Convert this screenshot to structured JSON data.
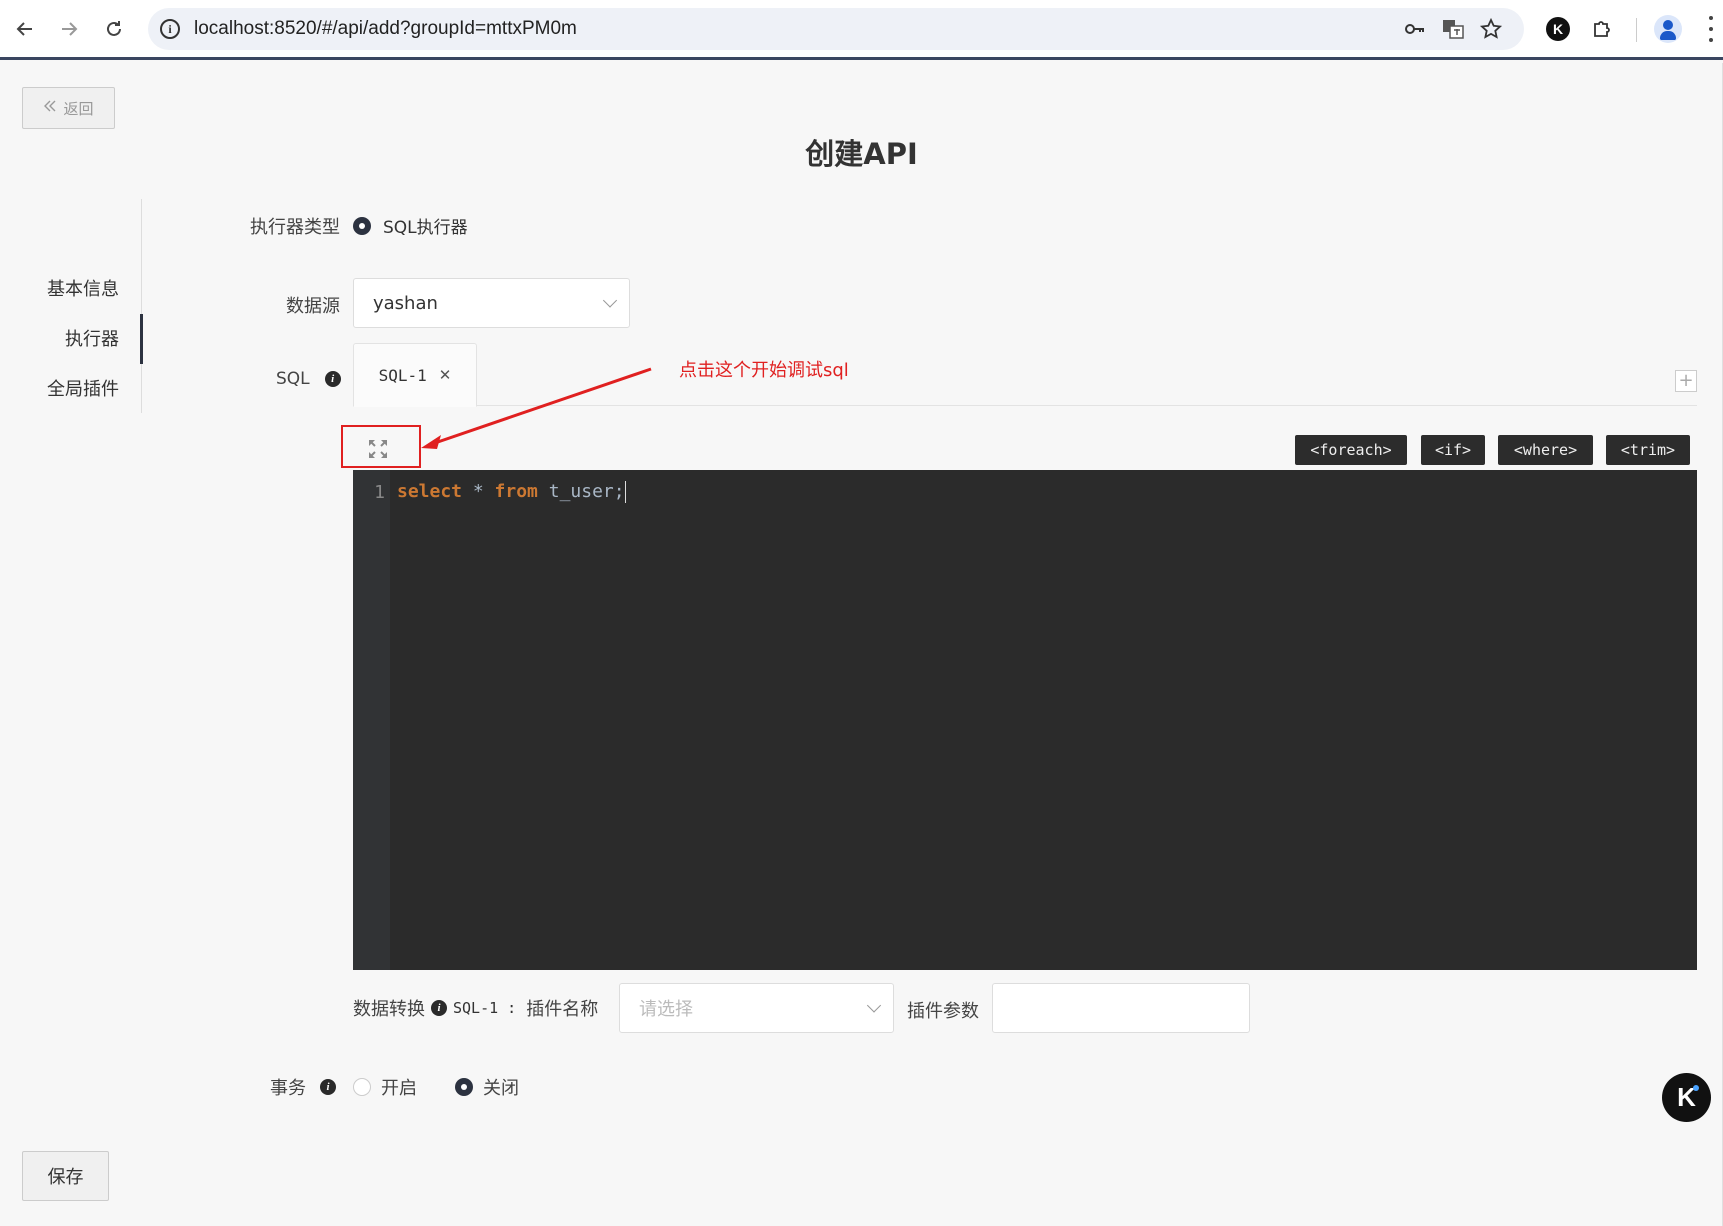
{
  "browser": {
    "url": "localhost:8520/#/api/add?groupId=mttxPM0m",
    "back_icon": "arrow-left-icon",
    "forward_icon": "arrow-right-icon",
    "reload_icon": "reload-icon",
    "k_extension_letter": "K"
  },
  "header": {
    "back_label": "返回",
    "title": "创建API"
  },
  "side_nav": {
    "items": [
      {
        "label": "基本信息"
      },
      {
        "label": "执行器"
      },
      {
        "label": "全局插件"
      }
    ],
    "active_index": 1
  },
  "form": {
    "executor_type_label": "执行器类型",
    "executor_option": "SQL执行器",
    "datasource_label": "数据源",
    "datasource_value": "yashan",
    "sql_label": "SQL",
    "sql_tabs": [
      {
        "label": "SQL-1"
      }
    ],
    "tag_buttons": [
      "<foreach>",
      "<if>",
      "<where>",
      "<trim>"
    ],
    "code_line_number": "1",
    "code_kw_select": "select",
    "code_star": " * ",
    "code_kw_from": "from",
    "code_table": " t_user;",
    "transform_label": "数据转换",
    "transform_sql_ref": "SQL-1 :",
    "plugin_name_label": "插件名称",
    "plugin_name_placeholder": "请选择",
    "plugin_param_label": "插件参数",
    "transaction_label": "事务",
    "transaction_on": "开启",
    "transaction_off": "关闭",
    "transaction_value": "关闭"
  },
  "annotation": {
    "text": "点击这个开始调试sql",
    "color": "#e02020"
  },
  "footer": {
    "save_label": "保存"
  },
  "floating": {
    "letter": "K"
  }
}
